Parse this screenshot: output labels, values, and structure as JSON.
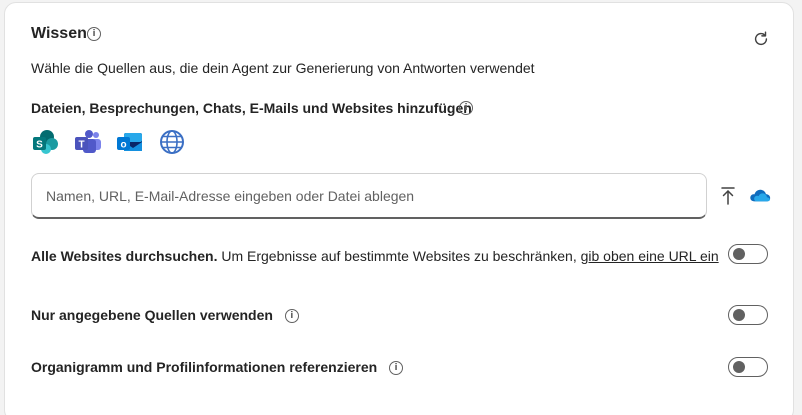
{
  "header": {
    "title": "Wissen",
    "subtitle": "Wähle die Quellen aus, die dein Agent zur Generierung von Antworten verwendet"
  },
  "sources": {
    "label": "Dateien, Besprechungen, Chats, E-Mails und Websites hinzufügen",
    "apps": [
      "sharepoint-icon",
      "teams-icon",
      "outlook-icon",
      "globe-icon"
    ]
  },
  "search": {
    "placeholder": "Namen, URL, E-Mail-Adresse eingeben oder Datei ablegen",
    "value": ""
  },
  "options": {
    "web_search": {
      "label": "Alle Websites durchsuchen.",
      "description": "Um Ergebnisse auf bestimmte Websites zu beschränken,",
      "link": "gib oben eine URL ein",
      "enabled": false
    },
    "only_sources": {
      "label": "Nur angegebene Quellen verwenden",
      "enabled": false
    },
    "org_chart": {
      "label": "Organigramm und Profilinformationen referenzieren",
      "enabled": false
    }
  },
  "colors": {
    "accent": "#0f6cbd",
    "toggle_off": "#616161"
  }
}
